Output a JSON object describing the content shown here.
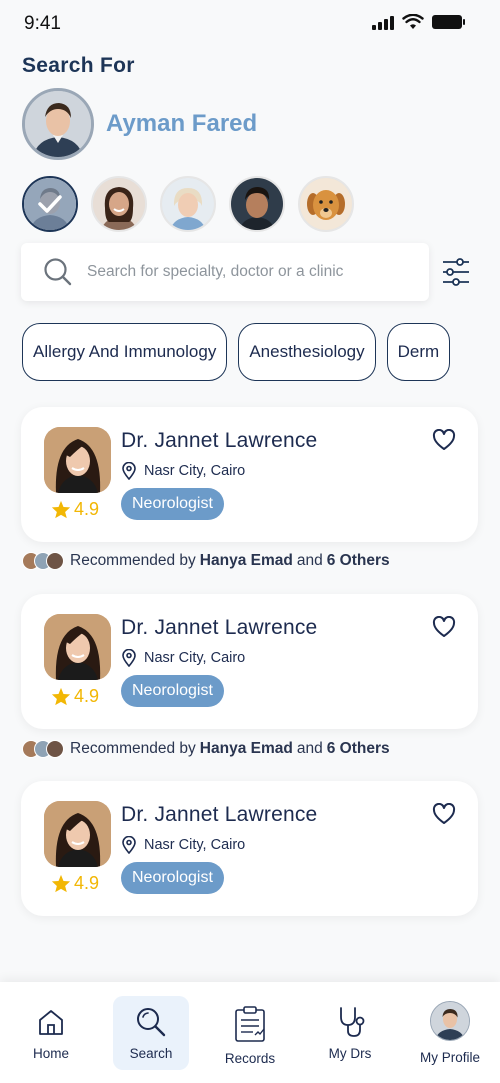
{
  "status_bar": {
    "time": "9:41"
  },
  "page": {
    "title": "Search For"
  },
  "main_user": {
    "name": "Ayman Fared"
  },
  "search": {
    "placeholder": "Search for specialty, doctor or a clinic"
  },
  "chips": [
    "Allergy And Immunology",
    "Anesthesiology",
    "Derm"
  ],
  "doctors": [
    {
      "name": "Dr. Jannet Lawrence",
      "location": "Nasr City, Cairo",
      "specialty": "Neorologist",
      "rating": "4.9"
    },
    {
      "name": "Dr. Jannet Lawrence",
      "location": "Nasr City, Cairo",
      "specialty": "Neorologist",
      "rating": "4.9"
    },
    {
      "name": "Dr. Jannet Lawrence",
      "location": "Nasr City, Cairo",
      "specialty": "Neorologist",
      "rating": "4.9"
    }
  ],
  "recommendations": [
    {
      "prefix": "Recommended by",
      "person": "Hanya Emad",
      "joiner": "and",
      "others": "6 Others"
    },
    {
      "prefix": "Recommended by",
      "person": "Hanya Emad",
      "joiner": "and",
      "others": "6 Others"
    }
  ],
  "bottom_nav": {
    "items": [
      {
        "label": "Home",
        "icon": "home-icon"
      },
      {
        "label": "Search",
        "icon": "search-icon",
        "active": true
      },
      {
        "label": "Records",
        "icon": "clipboard-icon"
      },
      {
        "label": "My Drs",
        "icon": "stethoscope-icon"
      },
      {
        "label": "My Profile",
        "icon": "avatar"
      }
    ]
  },
  "colors": {
    "navy": "#1d3557",
    "accent_blue": "#6c9bc9",
    "star": "#f2b705",
    "nav_active_bg": "#eaf2fb"
  }
}
